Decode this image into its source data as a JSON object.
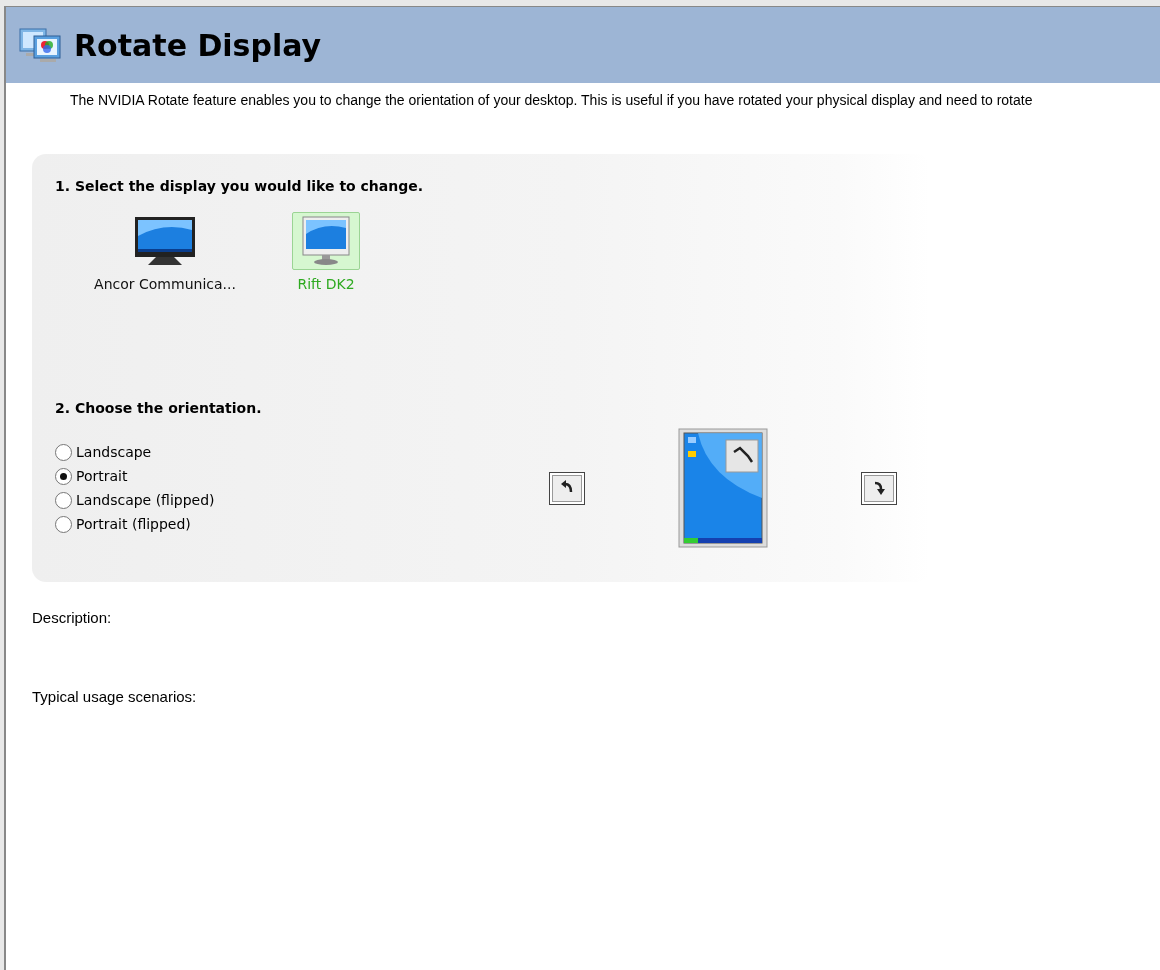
{
  "header": {
    "title": "Rotate Display"
  },
  "intro": "The NVIDIA Rotate feature enables you to change the orientation of your desktop. This is useful if you have rotated your physical display and need to rotate",
  "step1": {
    "heading": "1. Select the display you would like to change.",
    "displays": [
      {
        "name": "Ancor Communica...",
        "kind": "widescreen",
        "selected": false
      },
      {
        "name": "Rift DK2",
        "kind": "standard",
        "selected": true
      }
    ]
  },
  "step2": {
    "heading": "2. Choose the orientation.",
    "options": [
      {
        "label": "Landscape",
        "selected": false
      },
      {
        "label": "Portrait",
        "selected": true
      },
      {
        "label": "Landscape (flipped)",
        "selected": false
      },
      {
        "label": "Portrait (flipped)",
        "selected": false
      }
    ]
  },
  "description": {
    "label": "Description:"
  },
  "usage": {
    "label": "Typical usage scenarios:"
  }
}
